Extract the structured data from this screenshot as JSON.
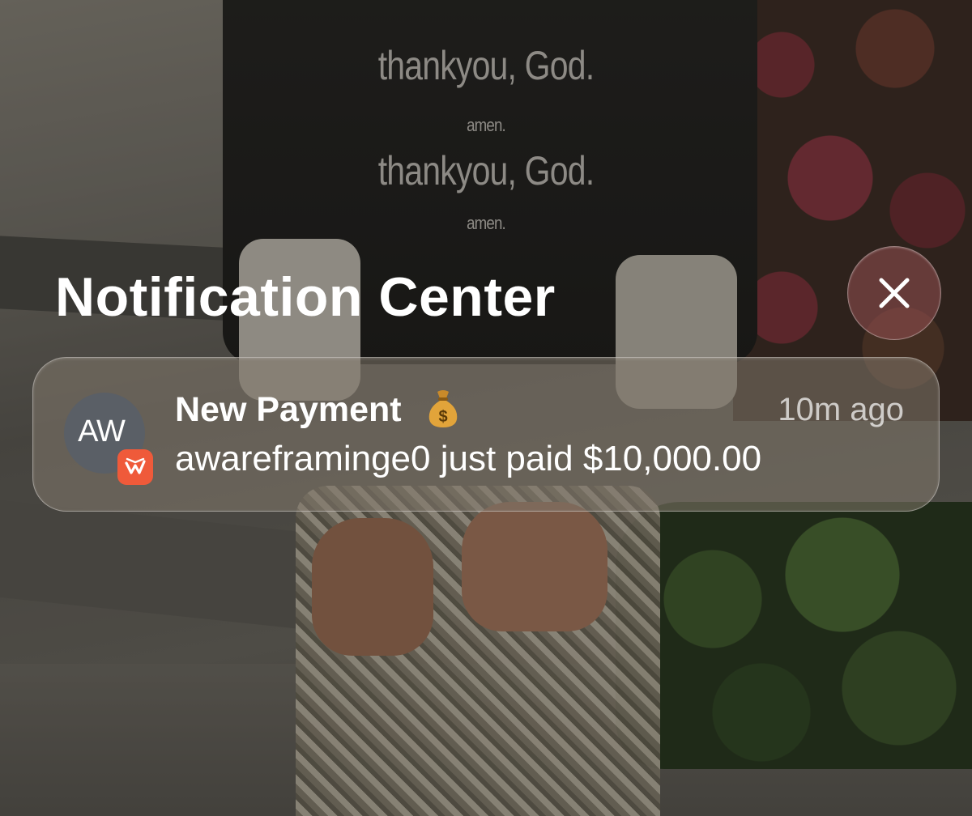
{
  "wallpaper": {
    "shirt_line1": "thankyou, God.",
    "shirt_line2": "amen.",
    "shirt_line3": "thankyou, God.",
    "shirt_line4": "amen."
  },
  "notification_center": {
    "title": "Notification Center",
    "close_icon": "close-icon"
  },
  "notification": {
    "avatar_initials": "AW",
    "app_icon": "payment-app-icon",
    "title": "New Payment",
    "title_icon": "money-bag-icon",
    "time": "10m ago",
    "body": "awareframinge0 just paid $10,000.00"
  },
  "colors": {
    "badge": "#ef5a3a",
    "avatar": "#5a5f66",
    "close_button": "#965052"
  }
}
